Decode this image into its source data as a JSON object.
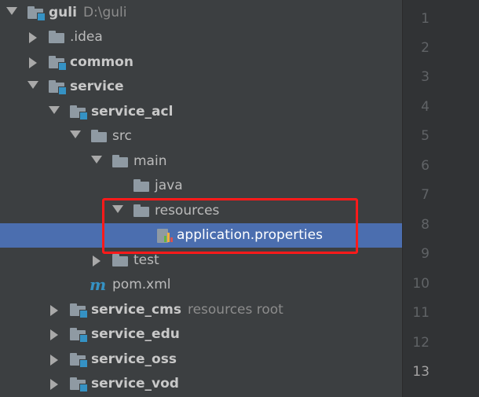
{
  "tree": {
    "items": [
      {
        "label": "guli",
        "hint": "D:\\guli"
      },
      {
        "label": ".idea"
      },
      {
        "label": "common"
      },
      {
        "label": "service"
      },
      {
        "label": "service_acl"
      },
      {
        "label": "src"
      },
      {
        "label": "main"
      },
      {
        "label": "java"
      },
      {
        "label": "resources"
      },
      {
        "label": "application.properties"
      },
      {
        "label": "test"
      },
      {
        "label": "pom.xml",
        "icon": "m"
      },
      {
        "label": "service_cms",
        "hint": "resources root"
      },
      {
        "label": "service_edu"
      },
      {
        "label": "service_oss"
      },
      {
        "label": "service_vod"
      }
    ]
  },
  "gutter": {
    "lines": [
      "1",
      "2",
      "3",
      "4",
      "5",
      "6",
      "7",
      "8",
      "9",
      "10",
      "11",
      "12",
      "13"
    ],
    "current": "13"
  },
  "colors": {
    "selection": "#4b6eaf",
    "highlight_box": "#ff1a1a",
    "module_badge": "#3592c4"
  }
}
